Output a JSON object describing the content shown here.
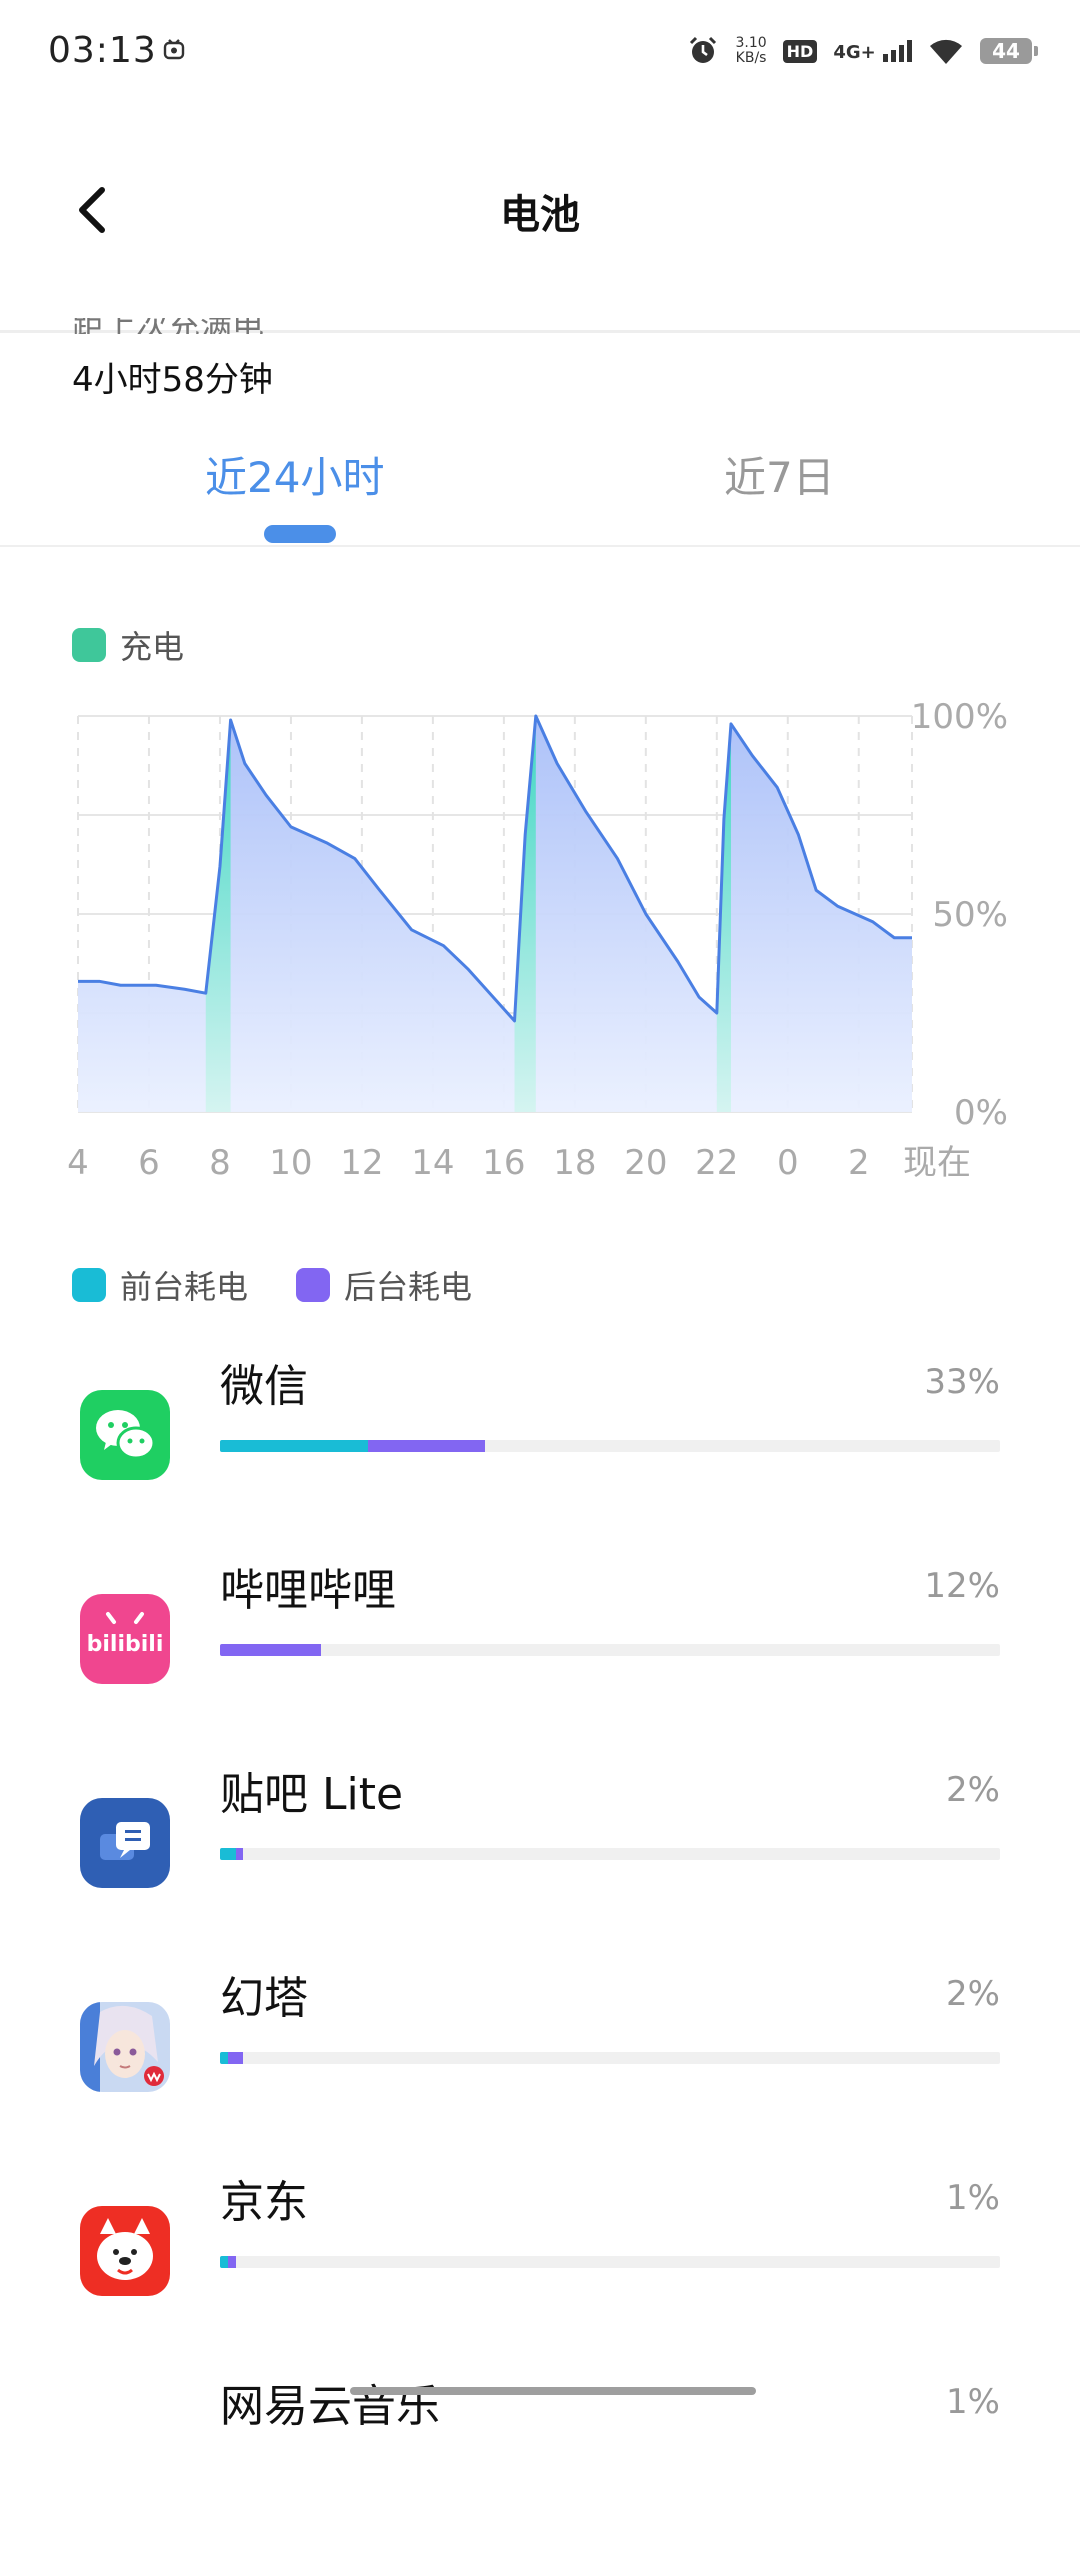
{
  "status_bar": {
    "time": "03:13",
    "net_speed_value": "3.10",
    "net_speed_unit": "KB/s",
    "hd": "HD",
    "network": "4G+",
    "battery": "44",
    "icons": [
      "app-notification-icon",
      "alarm-icon",
      "signal-icon",
      "wifi-icon",
      "battery-icon"
    ]
  },
  "header": {
    "title": "电池",
    "back_icon": "chevron-left-icon"
  },
  "summary": {
    "cut_label": "距上次充满电",
    "remaining": "4小时58分钟"
  },
  "tabs": [
    {
      "label": "近24小时",
      "active": true
    },
    {
      "label": "近7日",
      "active": false
    }
  ],
  "chart_legend": {
    "charging": "充电",
    "charging_color": "#3fc79a"
  },
  "chart_data": {
    "type": "area",
    "ylabel": "",
    "y_ticks": [
      "100%",
      "50%",
      "0%"
    ],
    "ylim": [
      0,
      100
    ],
    "x_ticks": [
      "4",
      "6",
      "8",
      "10",
      "12",
      "14",
      "16",
      "18",
      "20",
      "22",
      "0",
      "2",
      "现在"
    ],
    "x_hours": [
      4,
      6,
      8,
      10,
      12,
      14,
      16,
      18,
      20,
      22,
      24,
      26,
      27.5
    ],
    "xlim": [
      4,
      27.5
    ],
    "series": [
      {
        "points": [
          [
            4.0,
            33
          ],
          [
            4.6,
            33
          ],
          [
            5.2,
            32
          ],
          [
            6.2,
            32
          ],
          [
            7.0,
            31
          ],
          [
            7.6,
            30
          ],
          [
            8.0,
            62
          ],
          [
            8.3,
            99
          ],
          [
            8.7,
            88
          ],
          [
            9.3,
            80
          ],
          [
            10.0,
            72
          ],
          [
            11.0,
            68
          ],
          [
            11.8,
            64
          ],
          [
            12.5,
            56
          ],
          [
            13.4,
            46
          ],
          [
            14.3,
            42
          ],
          [
            15.0,
            36
          ],
          [
            15.8,
            28
          ],
          [
            16.3,
            23
          ],
          [
            16.6,
            70
          ],
          [
            16.9,
            100
          ],
          [
            17.5,
            88
          ],
          [
            18.3,
            76
          ],
          [
            19.2,
            64
          ],
          [
            20.0,
            50
          ],
          [
            20.9,
            38
          ],
          [
            21.5,
            29
          ],
          [
            22.0,
            25
          ],
          [
            22.2,
            74
          ],
          [
            22.4,
            98
          ],
          [
            23.0,
            90
          ],
          [
            23.7,
            82
          ],
          [
            24.3,
            70
          ],
          [
            24.8,
            56
          ],
          [
            25.4,
            52
          ],
          [
            26.4,
            48
          ],
          [
            27.0,
            44
          ],
          [
            27.5,
            44
          ]
        ]
      }
    ],
    "charging_periods": [
      [
        7.6,
        8.3
      ],
      [
        16.3,
        16.9
      ],
      [
        22.0,
        22.4
      ]
    ],
    "colors": {
      "line": "#4a7fe3",
      "fill_top": "#a9bff8",
      "fill_bottom": "#eaf0ff",
      "charge": "#3fd6c3"
    },
    "grid": true
  },
  "usage_legend": {
    "foreground": "前台耗电",
    "foreground_color": "#19bcd6",
    "background": "后台耗电",
    "background_color": "#8266f2"
  },
  "apps": [
    {
      "name": "微信",
      "percent_label": "33%",
      "foreground": 0.19,
      "background": 0.15,
      "icon": "wechat-icon"
    },
    {
      "name": "哔哩哔哩",
      "percent_label": "12%",
      "foreground": 0.0,
      "background": 0.13,
      "icon": "bilibili-icon"
    },
    {
      "name": "贴吧 Lite",
      "percent_label": "2%",
      "foreground": 0.02,
      "background": 0.01,
      "icon": "tieba-icon"
    },
    {
      "name": "幻塔",
      "percent_label": "2%",
      "foreground": 0.01,
      "background": 0.02,
      "icon": "tower-of-fantasy-icon"
    },
    {
      "name": "京东",
      "percent_label": "1%",
      "foreground": 0.01,
      "background": 0.01,
      "icon": "jd-icon"
    },
    {
      "name": "网易云音乐",
      "percent_label": "1%",
      "icon": "netease-music-icon"
    }
  ]
}
